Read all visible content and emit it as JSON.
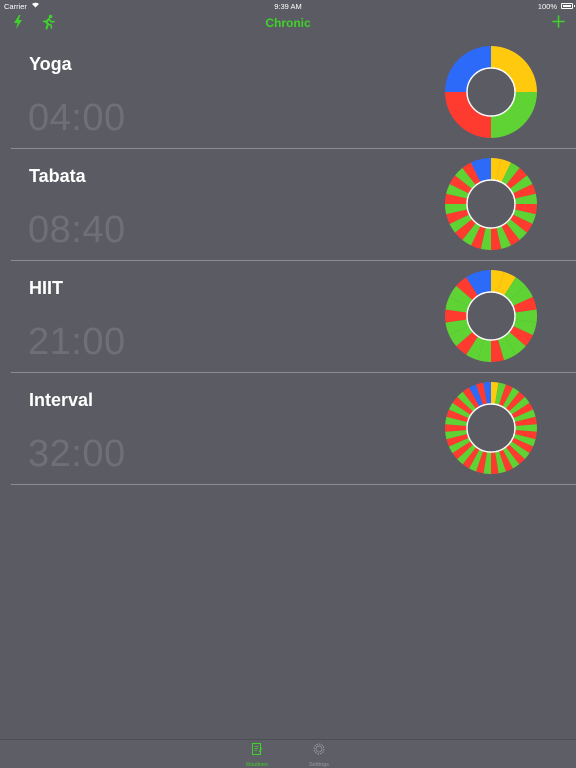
{
  "status_bar": {
    "carrier": "Carrier",
    "time": "9:39 AM",
    "battery": "100%"
  },
  "nav": {
    "title": "Chronic",
    "left_icons": [
      "bolt-icon",
      "runner-icon"
    ],
    "right_icon": "plus-icon"
  },
  "colors": {
    "accent": "#3ed32a",
    "background": "#5b5b63",
    "divider": "#8c8c92",
    "duration_text": "#6f6f76",
    "ring_yellow": "#ffc90e",
    "ring_green": "#5fd333",
    "ring_red": "#ff3b30",
    "ring_blue": "#2c6bfa"
  },
  "routines": [
    {
      "name": "Yoga",
      "duration": "04:00",
      "segments": [
        "Y",
        "G",
        "R",
        "B"
      ]
    },
    {
      "name": "Tabata",
      "duration": "08:40",
      "segments": [
        "Y",
        "Y",
        "G",
        "R",
        "G",
        "R",
        "G",
        "R",
        "G",
        "R",
        "G",
        "R",
        "G",
        "R",
        "G",
        "R",
        "G",
        "R",
        "G",
        "R",
        "G",
        "R",
        "G",
        "R",
        "G",
        "R",
        "B",
        "B"
      ]
    },
    {
      "name": "HIIT",
      "duration": "21:00",
      "segments": [
        "Y",
        "Y",
        "G",
        "G",
        "R",
        "G",
        "G",
        "R",
        "G",
        "G",
        "R",
        "G",
        "G",
        "R",
        "G",
        "G",
        "R",
        "G",
        "G",
        "R",
        "B",
        "B"
      ]
    },
    {
      "name": "Interval",
      "duration": "32:00",
      "segments": [
        "Y",
        "G",
        "R",
        "G",
        "R",
        "G",
        "R",
        "G",
        "R",
        "G",
        "R",
        "G",
        "R",
        "G",
        "R",
        "G",
        "R",
        "G",
        "R",
        "G",
        "R",
        "G",
        "R",
        "G",
        "R",
        "G",
        "R",
        "G",
        "R",
        "G",
        "R",
        "G",
        "R",
        "G",
        "R",
        "B",
        "R",
        "B"
      ]
    }
  ],
  "tab_bar": {
    "tabs": [
      {
        "label": "Routines",
        "icon": "notes-icon",
        "selected": true
      },
      {
        "label": "Settings",
        "icon": "gear-icon",
        "selected": false
      }
    ]
  }
}
